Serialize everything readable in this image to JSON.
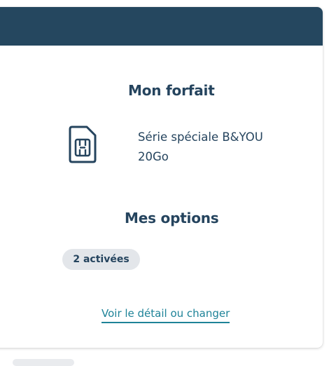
{
  "forfait": {
    "title": "Mon forfait",
    "plan_name": "Série spéciale B&YOU 20Go",
    "icon": "sim-card-icon"
  },
  "options": {
    "title": "Mes options",
    "badge": "2 activées"
  },
  "link": {
    "label": "Voir le détail ou changer"
  },
  "colors": {
    "header": "#25475f",
    "text": "#25445e",
    "link": "#1e8398",
    "badge_bg": "#e3e6ea"
  }
}
